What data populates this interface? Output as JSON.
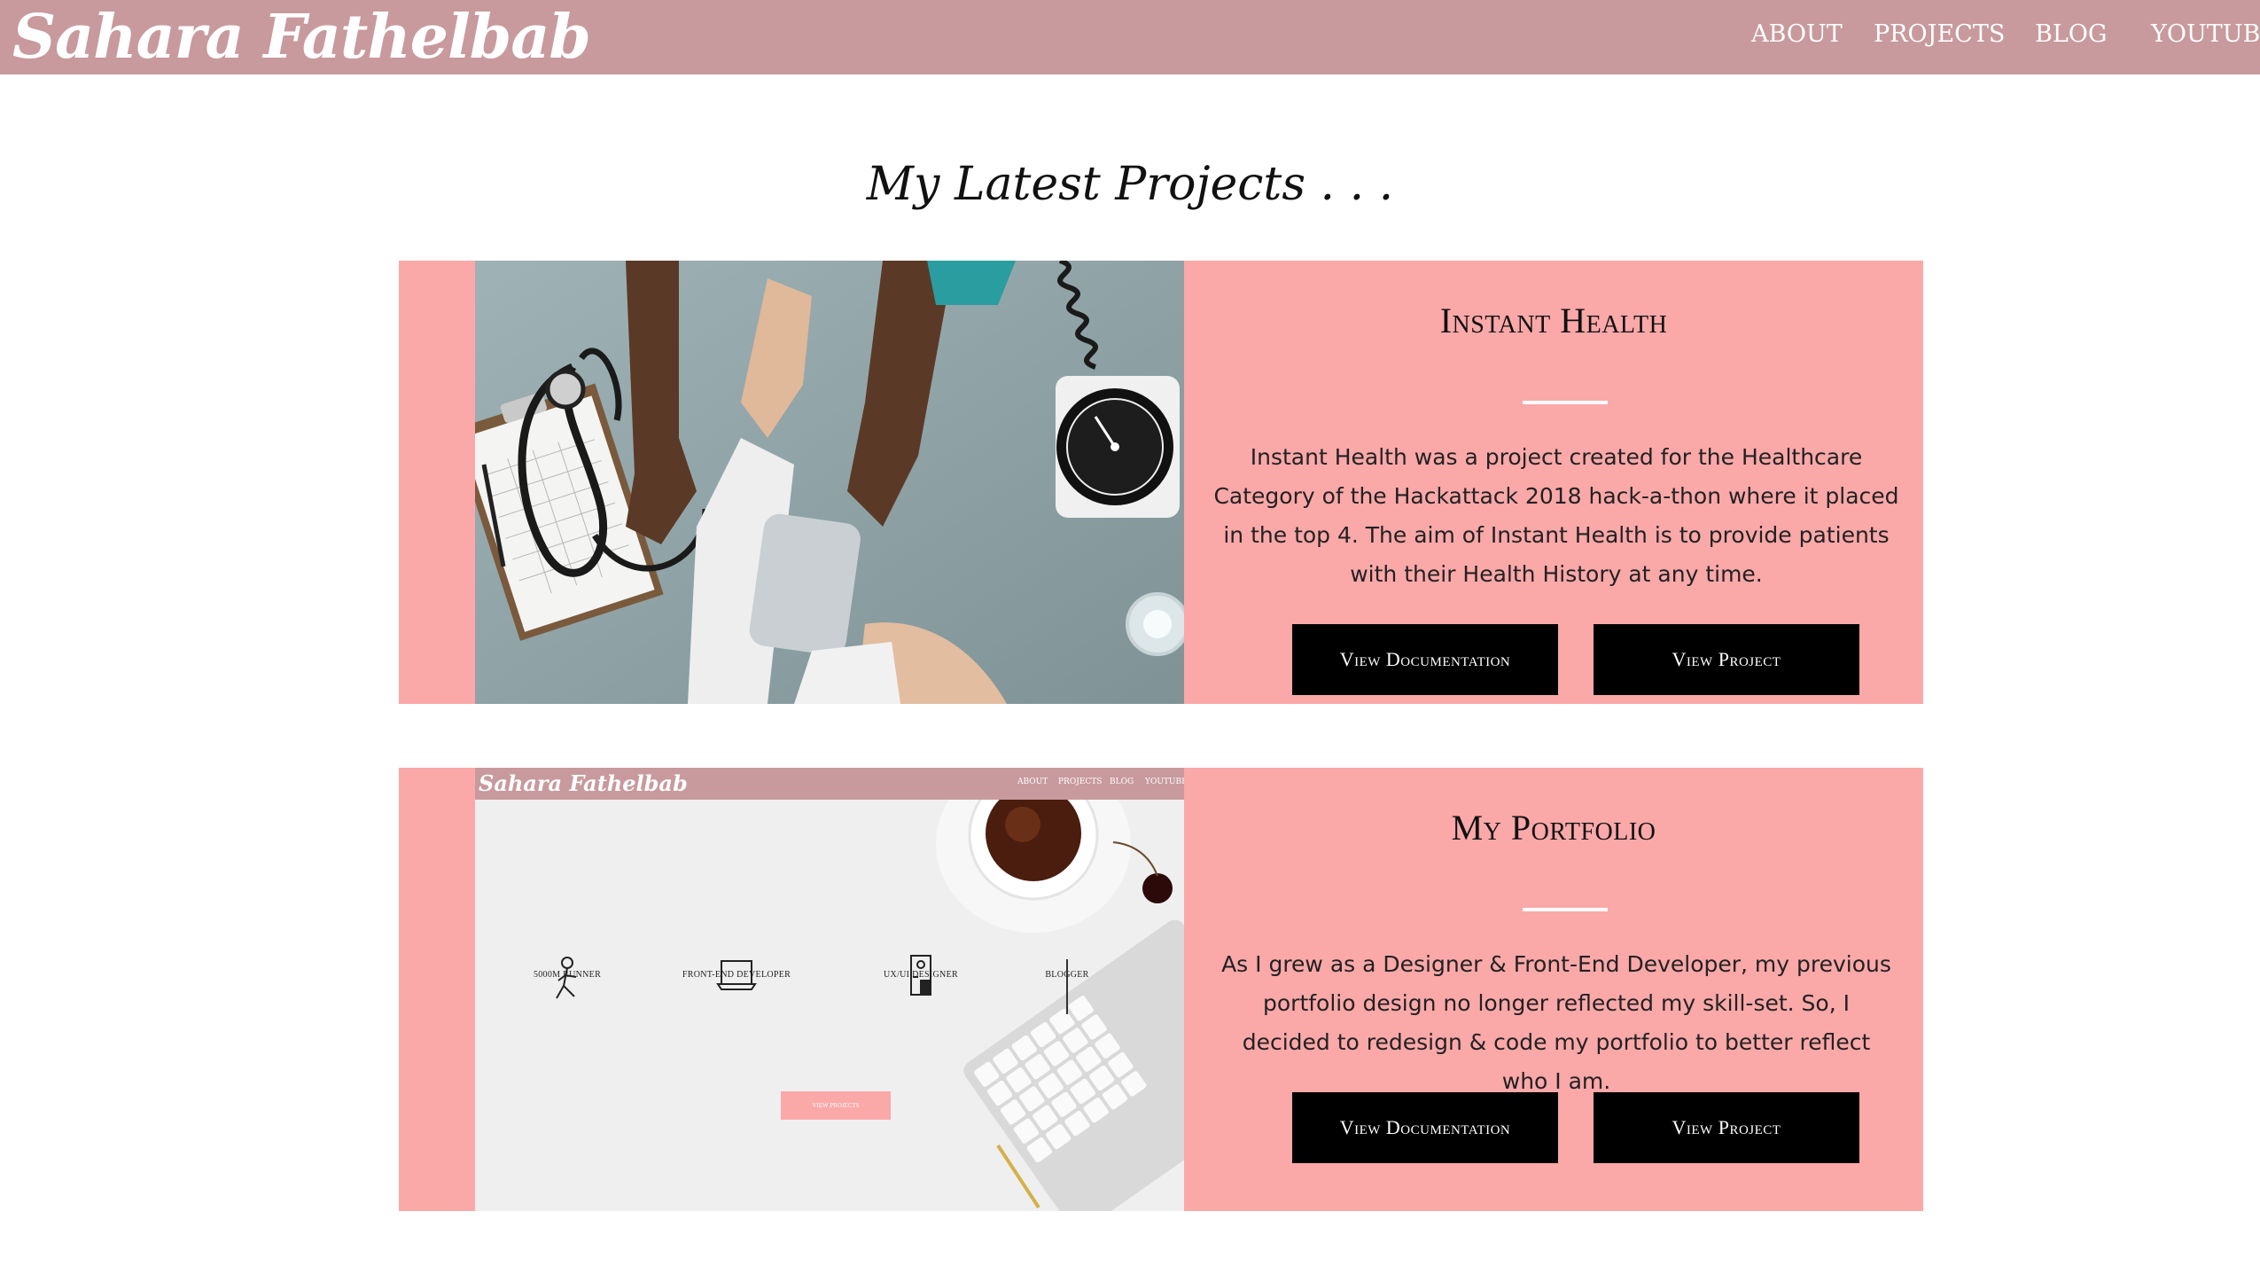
{
  "brand": "Sahara Fathelbab",
  "nav": [
    {
      "label": "ABOUT"
    },
    {
      "label": "PROJECTS"
    },
    {
      "label": "BLOG"
    },
    {
      "label": "YOUTUBE"
    }
  ],
  "section_title": "My Latest Projects . . .",
  "projects": [
    {
      "title": "Instant Health",
      "description": "Instant Health was a project created for the Healthcare Category of the Hackattack 2018 hack-a-thon where it placed in the top 4. The aim of Instant Health is to provide patients with their Health History at any time.",
      "buttons": {
        "documentation": "View Documentation",
        "project": "View Project"
      }
    },
    {
      "title": "My Portfolio",
      "description": "As I grew as a Designer & Front-End Developer, my previous portfolio design no longer reflected my skill-set. So, I decided to redesign & code my portfolio to better reflect who I am.",
      "buttons": {
        "documentation": "View Documentation",
        "project": "View Project"
      },
      "preview": {
        "brand": "Sahara Fathelbab",
        "nav": [
          "ABOUT",
          "PROJECTS",
          "BLOG",
          "YOUTUBE"
        ],
        "roles": [
          "5000M RUNNER",
          "FRONT-END DEVELOPER",
          "UX/UI DESIGNER",
          "BLOGGER"
        ],
        "button": "VIEW PROJECTS"
      }
    }
  ],
  "colors": {
    "header": "#c89a9d",
    "card": "#fba8a9",
    "button": "#000000",
    "text": "#111111"
  }
}
